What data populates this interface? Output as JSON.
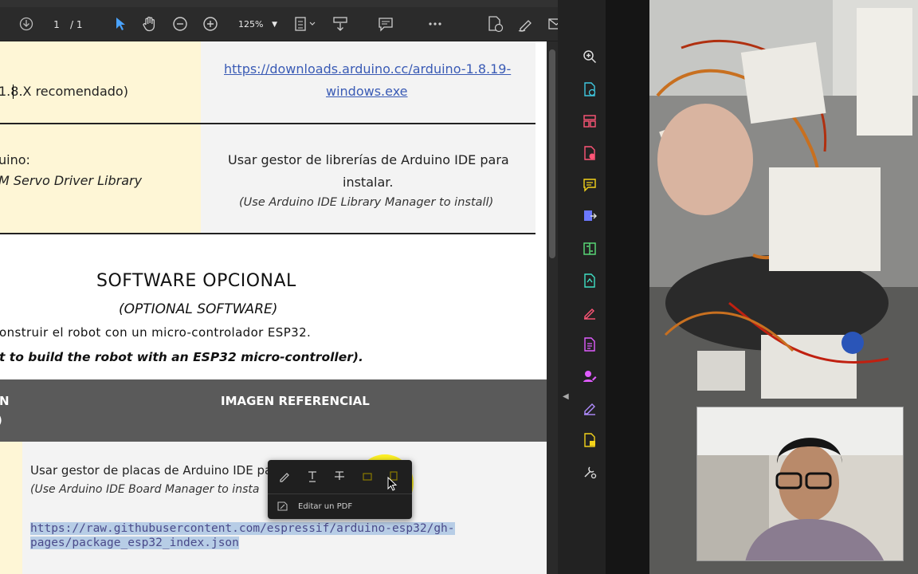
{
  "toolbar": {
    "page_current": "1",
    "page_total": "/ 1",
    "zoom": "125%"
  },
  "doc": {
    "row1_left": "1.8.X recomendado)",
    "row1_link_line1": "https://downloads.arduino.cc/arduino-1.8.19-",
    "row1_link_line2": "windows.exe",
    "row2_left_line1": "uino:",
    "row2_left_line2": "M Servo Driver Library",
    "row2_right_line1": "Usar gestor de librerías de Arduino IDE para",
    "row2_right_line2": "instalar.",
    "row2_right_line3": "(Use Arduino IDE Library Manager to install)",
    "section_title": "SOFTWARE OPCIONAL",
    "section_subtitle": "(OPTIONAL SOFTWARE)",
    "section_line1": "onstruir el robot con un micro-controlador ESP32.",
    "section_line2": "t to build the robot with an ESP32 micro-controller).",
    "header_left_1": "N",
    "header_left_2": ")",
    "header_right": "IMAGEN REFERENCIAL",
    "bottom_line1": "Usar gestor de placas de Arduino IDE par",
    "bottom_line2": "(Use Arduino IDE Board  Manager to insta",
    "bottom_url1": "https://raw.githubusercontent.com/espressif/arduino-esp32/gh-",
    "bottom_url2": "pages/package_esp32_index.json"
  },
  "popup": {
    "edit_label": "Editar un PDF"
  },
  "colors": {
    "yellow_cell": "#fef6d6",
    "link": "#3a5bb5",
    "selection": "#b7cde6",
    "highlight": "#fff000"
  },
  "icons": {
    "toolbar": [
      "download-icon",
      "select-arrow-icon",
      "hand-icon",
      "zoom-out-icon",
      "zoom-in-icon",
      "fit-page-icon",
      "scroll-mode-icon",
      "comment-icon",
      "more-icon",
      "edit-pdf-icon",
      "sign-icon",
      "email-icon",
      "account-icon"
    ],
    "right_panel": [
      "search-icon",
      "create-pdf-icon",
      "organize-pages-icon",
      "delete-pdf-icon",
      "comment-icon",
      "export-pdf-icon",
      "compress-icon",
      "convert-icon",
      "fill-sign-icon",
      "edit-icon",
      "request-signature-icon",
      "sign-icon",
      "protect-icon",
      "tools-icon"
    ]
  }
}
